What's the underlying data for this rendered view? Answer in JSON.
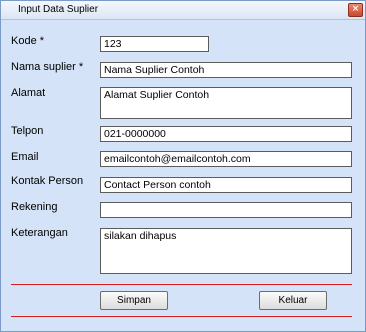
{
  "window": {
    "title": "Input Data Suplier",
    "close_symbol": "×"
  },
  "form": {
    "kode": {
      "label": "Kode *",
      "value": "123"
    },
    "nama": {
      "label": "Nama suplier *",
      "value": "Nama Suplier Contoh"
    },
    "alamat": {
      "label": "Alamat",
      "value": "Alamat Suplier Contoh"
    },
    "telpon": {
      "label": "Telpon",
      "value": "021-0000000"
    },
    "email": {
      "label": "Email",
      "value": "emailcontoh@emailcontoh.com"
    },
    "kontak": {
      "label": "Kontak Person",
      "value": "Contact Person contoh"
    },
    "rekening": {
      "label": "Rekening",
      "value": ""
    },
    "keterangan": {
      "label": "Keterangan",
      "value": "silakan dihapus"
    }
  },
  "buttons": {
    "simpan": {
      "label": "Simpan"
    },
    "keluar": {
      "label": "Keluar"
    }
  },
  "colors": {
    "window_bg": "#d4e3f7",
    "separator": "#d42020",
    "close_button": "#c8492e"
  }
}
